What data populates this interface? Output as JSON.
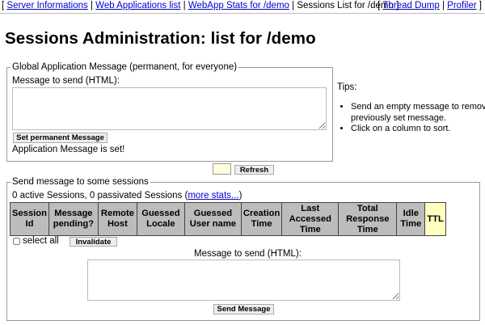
{
  "nav": {
    "open_bracket": "[",
    "sep": "|",
    "items": [
      "Server Informations",
      "Web Applications list",
      "WebApp Stats for /demo"
    ],
    "current": "Sessions List for /demo",
    "close_bracket": "]",
    "right_items": [
      "Thread Dump",
      "Profiler"
    ]
  },
  "page_title": "Sessions Administration: list for /demo",
  "global_message": {
    "legend": "Global Application Message (permanent, for everyone)",
    "message_label": "Message to send (HTML):",
    "message_value": "",
    "set_button": "Set permanent Message",
    "status": "Application Message is set!"
  },
  "tips": {
    "title": "Tips:",
    "items": [
      "Send an empty message to remove previously set message.",
      "Click on a column to sort."
    ]
  },
  "refresh": {
    "input_value": "",
    "button": "Refresh"
  },
  "send_sessions": {
    "legend": "Send message to some sessions",
    "summary_prefix": "0 active Sessions, 0 passivated Sessions (",
    "more_stats": "more stats...",
    "summary_suffix": ")",
    "columns": [
      "Session Id",
      "Message pending?",
      "Remote Host",
      "Guessed Locale",
      "Guessed User name",
      "Creation Time",
      "Last Accessed Time",
      "Total Response Time",
      "Idle Time",
      "TTL"
    ],
    "select_all": "select all",
    "invalidate_button": "Invalidate",
    "message_label": "Message to send (HTML):",
    "message_value": "",
    "send_button": "Send Message"
  }
}
